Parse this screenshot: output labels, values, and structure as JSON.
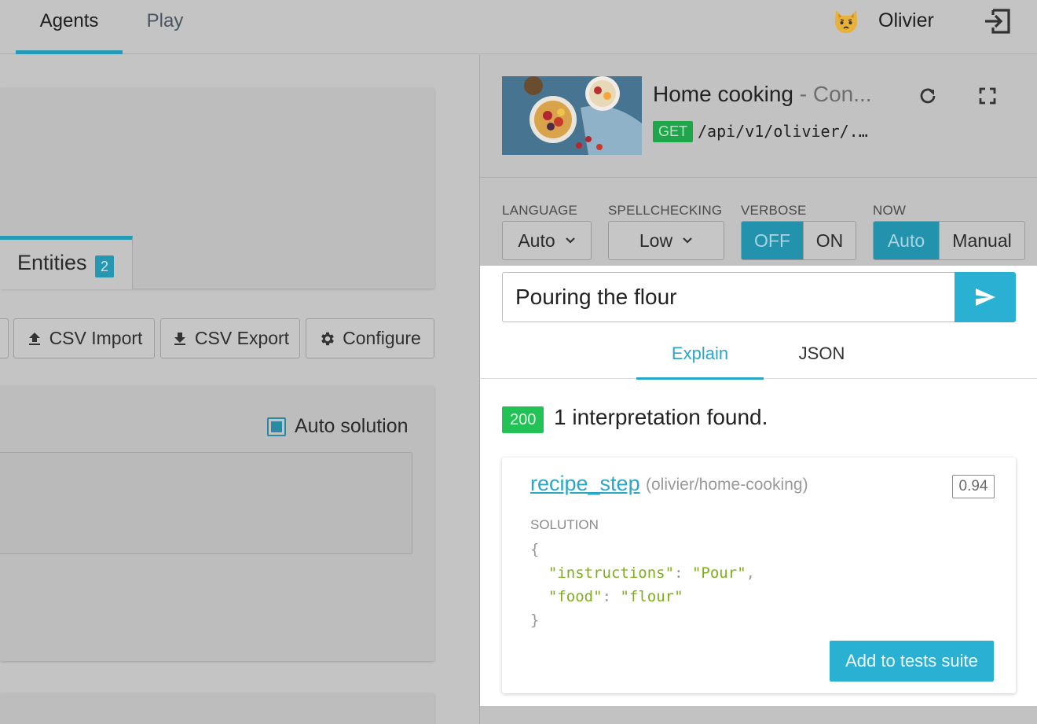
{
  "nav": {
    "tabs": [
      {
        "label": "Agents",
        "active": true
      },
      {
        "label": "Play",
        "active": false
      }
    ],
    "user": {
      "name": "Olivier",
      "avatar_icon": "cat-avatar-icon"
    },
    "logout_icon": "logout-icon"
  },
  "left": {
    "entities_tab": {
      "label": "Entities",
      "count": "2"
    },
    "buttons": {
      "csv_import": "CSV Import",
      "csv_export": "CSV Export",
      "configure": "Configure"
    },
    "auto_solution": {
      "label": "Auto solution",
      "checked": true
    }
  },
  "panel": {
    "agent": {
      "title": "Home cooking",
      "subtitle": "Con...",
      "method": "GET",
      "endpoint": "/api/v1/olivier/..."
    },
    "options": {
      "language": {
        "label": "LANGUAGE",
        "value": "Auto"
      },
      "spellchecking": {
        "label": "SPELLCHECKING",
        "value": "Low"
      },
      "verbose": {
        "label": "VERBOSE",
        "options": [
          "OFF",
          "ON"
        ],
        "selected": "OFF"
      },
      "now": {
        "label": "NOW",
        "options": [
          "Auto",
          "Manual"
        ],
        "selected": "Auto"
      }
    },
    "query": "Pouring the flour",
    "tabs": [
      {
        "label": "Explain",
        "active": true
      },
      {
        "label": "JSON",
        "active": false
      }
    ],
    "status_code": "200",
    "result_text": "1 interpretation found.",
    "interpretation": {
      "intent": "recipe_step",
      "agent_ref": "(olivier/home-cooking)",
      "score": "0.94",
      "solution_label": "SOLUTION",
      "solution": {
        "instructions": "Pour",
        "food": "flour"
      }
    },
    "add_button": "Add to tests suite"
  },
  "colors": {
    "accent": "#2ab0d2",
    "success": "#22c256",
    "get_badge": "#1fa64a",
    "string": "#7fae1c"
  }
}
